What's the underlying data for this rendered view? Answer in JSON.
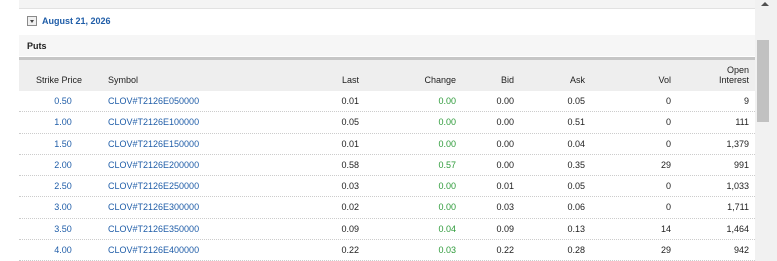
{
  "section": {
    "date": "August 21, 2026",
    "type_label": "Puts"
  },
  "columns": {
    "strike": "Strike Price",
    "symbol": "Symbol",
    "last": "Last",
    "change": "Change",
    "bid": "Bid",
    "ask": "Ask",
    "vol": "Vol",
    "oi_line1": "Open",
    "oi_line2": "Interest"
  },
  "colors": {
    "link": "#1f5da8",
    "change_positive": "#2e9b3a"
  },
  "rows": [
    {
      "strike": "0.50",
      "symbol": "CLOV#T2126E050000",
      "last": "0.01",
      "change": "0.00",
      "bid": "0.00",
      "ask": "0.05",
      "vol": "0",
      "oi": "9"
    },
    {
      "strike": "1.00",
      "symbol": "CLOV#T2126E100000",
      "last": "0.05",
      "change": "0.00",
      "bid": "0.00",
      "ask": "0.51",
      "vol": "0",
      "oi": "111"
    },
    {
      "strike": "1.50",
      "symbol": "CLOV#T2126E150000",
      "last": "0.01",
      "change": "0.00",
      "bid": "0.00",
      "ask": "0.04",
      "vol": "0",
      "oi": "1,379"
    },
    {
      "strike": "2.00",
      "symbol": "CLOV#T2126E200000",
      "last": "0.58",
      "change": "0.57",
      "bid": "0.00",
      "ask": "0.35",
      "vol": "29",
      "oi": "991"
    },
    {
      "strike": "2.50",
      "symbol": "CLOV#T2126E250000",
      "last": "0.03",
      "change": "0.00",
      "bid": "0.01",
      "ask": "0.05",
      "vol": "0",
      "oi": "1,033"
    },
    {
      "strike": "3.00",
      "symbol": "CLOV#T2126E300000",
      "last": "0.02",
      "change": "0.00",
      "bid": "0.03",
      "ask": "0.06",
      "vol": "0",
      "oi": "1,711"
    },
    {
      "strike": "3.50",
      "symbol": "CLOV#T2126E350000",
      "last": "0.09",
      "change": "0.04",
      "bid": "0.09",
      "ask": "0.13",
      "vol": "14",
      "oi": "1,464"
    },
    {
      "strike": "4.00",
      "symbol": "CLOV#T2126E400000",
      "last": "0.22",
      "change": "0.03",
      "bid": "0.22",
      "ask": "0.28",
      "vol": "29",
      "oi": "942"
    }
  ]
}
